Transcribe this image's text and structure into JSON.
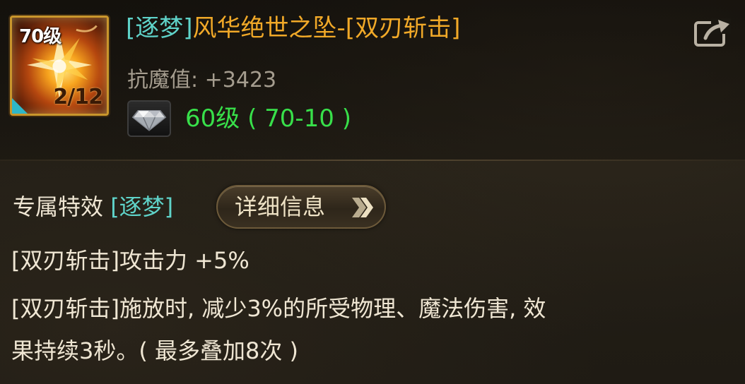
{
  "item": {
    "level_badge": "70级",
    "stack_count": "2/12",
    "title_tag": "[逐梦]",
    "title_name": "风华绝世之坠-[双刃斩击]",
    "icon_name": "star-burst-icon"
  },
  "stats": {
    "magic_resist": "抗魔值: +3423",
    "gem_level": "60级 ( 70-10 )",
    "gem_icon": "diamond-gem-icon"
  },
  "exclusive": {
    "label": "专属特效",
    "tag": "[逐梦]",
    "detail_button": "详细信息"
  },
  "effects": {
    "line1": "[双刃斩击]攻击力 +5%",
    "line2": "[双刃斩击]施放时, 减少3%的所受物理、魔法伤害, 效",
    "line3": "果持续3秒。( 最多叠加8次 )"
  },
  "colors": {
    "tag": "#5fd3c9",
    "name": "#f1a928",
    "gem_level": "#38e04a",
    "stat": "#a59d8f",
    "text": "#efe6d3"
  },
  "icons": {
    "share": "share-export-icon",
    "chevrons": "double-chevron-right-icon"
  }
}
